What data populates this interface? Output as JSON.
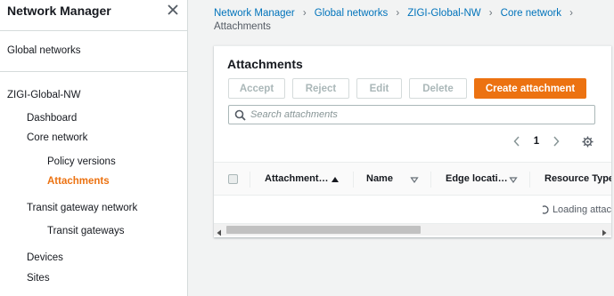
{
  "sidebar": {
    "title": "Network Manager",
    "global_networks": "Global networks",
    "network_name": "ZIGI-Global-NW",
    "items": {
      "dashboard": "Dashboard",
      "core_network": "Core network",
      "policy_versions": "Policy versions",
      "attachments": "Attachments",
      "transit_gateway_network": "Transit gateway network",
      "transit_gateways": "Transit gateways",
      "devices": "Devices",
      "sites": "Sites"
    }
  },
  "breadcrumb": {
    "items": [
      "Network Manager",
      "Global networks",
      "ZIGI-Global-NW",
      "Core network"
    ],
    "current": "Attachments"
  },
  "panel": {
    "title": "Attachments",
    "buttons": {
      "accept": "Accept",
      "reject": "Reject",
      "edit": "Edit",
      "delete": "Delete",
      "create": "Create attachment"
    },
    "search_placeholder": "Search attachments",
    "page_number": "1",
    "columns": [
      "Attachment…",
      "Name",
      "Edge locati…",
      "Resource Type"
    ],
    "loading_text": "Loading attac"
  },
  "colors": {
    "accent": "#ec7211",
    "link": "#0073bb"
  }
}
